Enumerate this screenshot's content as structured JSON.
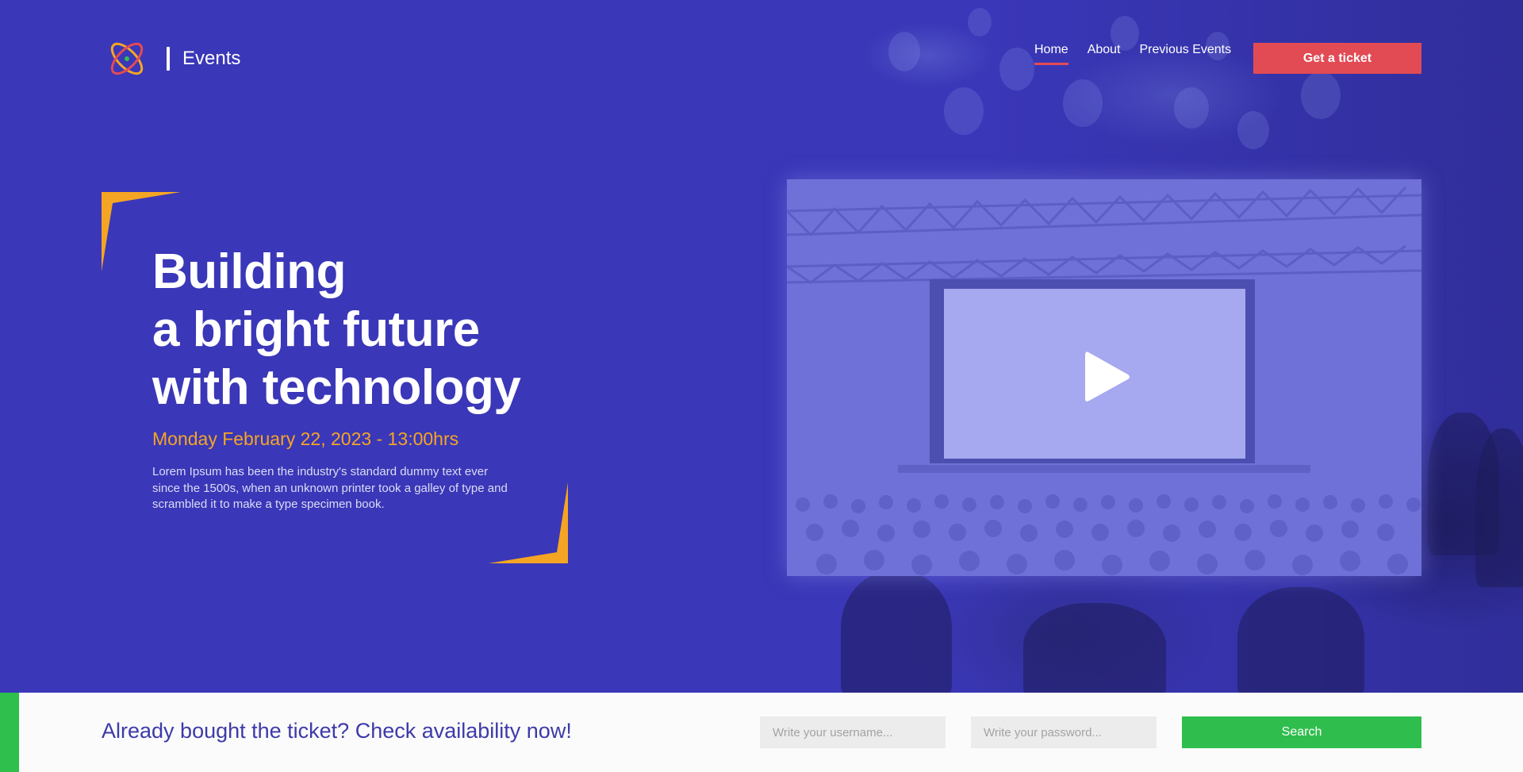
{
  "header": {
    "brand": "Events",
    "nav": [
      {
        "label": "Home",
        "active": true
      },
      {
        "label": "About",
        "active": false
      },
      {
        "label": "Previous Events",
        "active": false
      }
    ],
    "cta_label": "Get a ticket"
  },
  "hero": {
    "title_lines": [
      "Building",
      "a bright future",
      "with technology"
    ],
    "date": "Monday February 22, 2023 - 13:00hrs",
    "description": "Lorem Ipsum has been the industry's standard dummy text ever since the 1500s, when an unknown printer took a galley of type and scrambled it to make a type specimen book.",
    "video": {
      "icon": "play-icon"
    }
  },
  "check": {
    "title": "Already bought the ticket? Check availability now!",
    "username_placeholder": "Write your username...",
    "password_placeholder": "Write your password...",
    "search_label": "Search"
  },
  "colors": {
    "background": "#3a37b8",
    "accent_red": "#e24b54",
    "accent_orange": "#f5a524",
    "accent_green": "#2fbe4d",
    "heading_blue": "#3d3aa8"
  }
}
